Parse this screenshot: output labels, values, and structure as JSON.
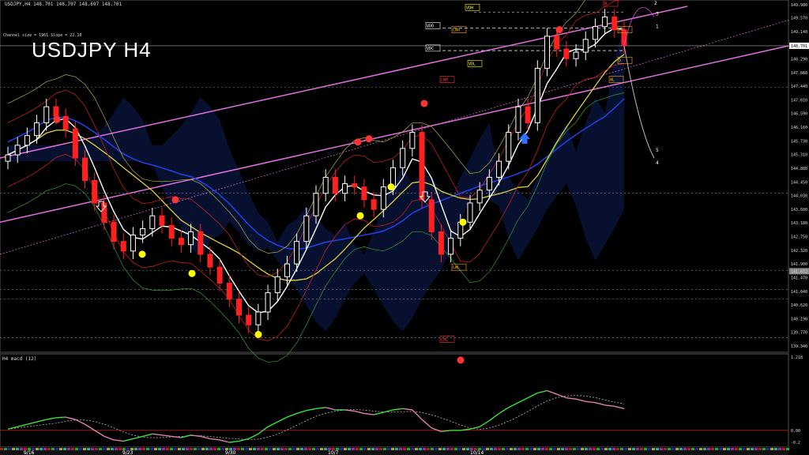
{
  "header": {
    "symbol_line": "USDJPY,H4  148.701 148.707 148.697 148.701",
    "title": "USDJPY H4",
    "channel_info": "Channel size = 1961 Slope = 22.10"
  },
  "subwindow": {
    "label": "H4 macd (12)"
  },
  "level_tags": {
    "vdh": "VDH",
    "lwh": "LWH",
    "vdo": "VDO",
    "vdc": "VDC",
    "vdl": "VDL",
    "lwl": "LWL",
    "lwh2": "LWH",
    "lml": "LML",
    "d1": "D",
    "d2": "D",
    "wl": "WL",
    "w2": "W"
  },
  "projection_labels": [
    "3",
    "1",
    "2",
    "5",
    "4"
  ],
  "colors": {
    "background": "#000000",
    "bull_candle": "#ffffff",
    "bear_candle": "#ff2020",
    "channel": "#e070e0",
    "ma_white": "#ffffff",
    "ma_yellow": "#e0d040",
    "ma_blue": "#2040e0",
    "cloud": "#2040c0",
    "macd_up": "#40e040",
    "macd_down": "#e080b0",
    "signal": "#bbbbbb",
    "zero_line": "#cc2020"
  },
  "chart_data": {
    "type": "candlestick",
    "symbol": "USDJPY",
    "timeframe": "H4",
    "ylim": [
      139.34,
      149.98
    ],
    "y_ticks": [
      "149.980",
      "149.570",
      "149.140",
      "148.701",
      "148.290",
      "147.860",
      "147.440",
      "147.010",
      "146.590",
      "146.160",
      "145.730",
      "145.310",
      "144.880",
      "144.450",
      "144.030",
      "143.600",
      "143.180",
      "142.750",
      "142.320",
      "141.900",
      "141.470",
      "141.040",
      "140.620",
      "140.190",
      "139.770",
      "139.340"
    ],
    "current_price": "148.701",
    "secondary_price_tag": "141.672",
    "x_ticks": [
      "9/16",
      "9/23",
      "9/30",
      "10/7",
      "10/14"
    ],
    "closes": [
      145.3,
      145.6,
      145.9,
      146.3,
      146.8,
      146.5,
      146.1,
      145.2,
      144.5,
      143.8,
      143.2,
      142.6,
      142.3,
      142.8,
      143.0,
      143.4,
      143.1,
      142.7,
      142.5,
      142.9,
      142.2,
      141.8,
      141.3,
      140.8,
      140.3,
      140.0,
      140.4,
      141.0,
      141.5,
      141.9,
      142.6,
      143.4,
      144.1,
      144.6,
      144.1,
      144.4,
      144.3,
      143.9,
      143.6,
      144.3,
      144.9,
      145.5,
      146.0,
      143.9,
      142.9,
      142.2,
      142.7,
      143.2,
      143.8,
      144.2,
      144.6,
      145.1,
      146.0,
      146.8,
      146.3,
      148.0,
      149.0,
      148.6,
      148.3,
      148.5,
      148.9,
      149.3,
      149.6,
      149.2,
      148.7
    ],
    "macd": {
      "label": "H4 macd (12)",
      "ylim": [
        -0.2,
        1.218
      ],
      "y_ticks": [
        "1.218",
        "0.00",
        "-0.2"
      ],
      "values": [
        0.02,
        0.06,
        0.1,
        0.14,
        0.18,
        0.21,
        0.22,
        0.18,
        0.1,
        0.0,
        -0.1,
        -0.16,
        -0.18,
        -0.14,
        -0.1,
        -0.06,
        -0.08,
        -0.1,
        -0.12,
        -0.08,
        -0.1,
        -0.14,
        -0.16,
        -0.2,
        -0.18,
        -0.14,
        -0.06,
        0.06,
        0.14,
        0.22,
        0.28,
        0.33,
        0.36,
        0.38,
        0.34,
        0.34,
        0.32,
        0.28,
        0.26,
        0.3,
        0.34,
        0.36,
        0.34,
        0.18,
        0.04,
        -0.02,
        0.0,
        0.0,
        0.02,
        0.06,
        0.16,
        0.28,
        0.38,
        0.46,
        0.54,
        0.62,
        0.66,
        0.6,
        0.54,
        0.52,
        0.48,
        0.46,
        0.42,
        0.4,
        0.36
      ]
    }
  }
}
